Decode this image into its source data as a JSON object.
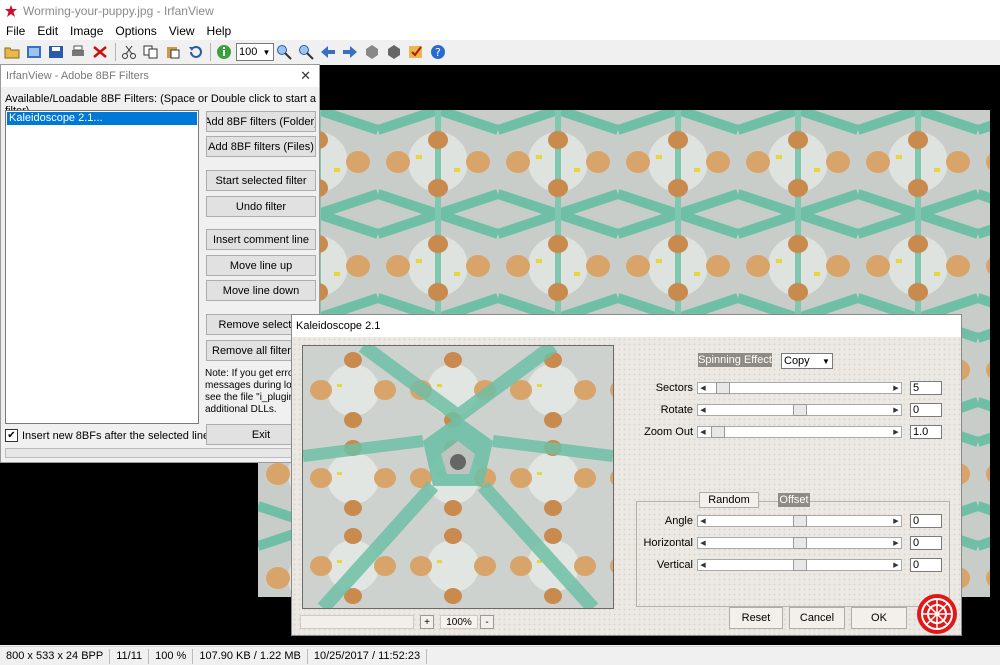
{
  "window": {
    "title": "Worming-your-puppy.jpg - IrfanView"
  },
  "menu": [
    "File",
    "Edit",
    "Image",
    "Options",
    "View",
    "Help"
  ],
  "toolbar": {
    "zoom_value": "100"
  },
  "status": {
    "dimensions": "800 x 533 x 24 BPP",
    "index": "11/11",
    "zoom": "100 %",
    "filesize": "107.90 KB / 1.22 MB",
    "datetime": "10/25/2017 / 11:52:23"
  },
  "filters_dialog": {
    "title": "IrfanView - Adobe 8BF Filters",
    "description": "Available/Loadable 8BF Filters: (Space or Double click to start a filter)",
    "list_items": [
      "Kaleidoscope 2.1..."
    ],
    "buttons": {
      "add_folder": "Add 8BF filters (Folder)",
      "add_files": "Add 8BF filters (Files)",
      "start": "Start selected filter",
      "undo": "Undo filter",
      "insert_comment": "Insert comment line",
      "move_up": "Move line up",
      "move_down": "Move line down",
      "remove_selected": "Remove selected",
      "remove_all": "Remove all filters/",
      "exit": "Exit"
    },
    "note": "Note: If you get erro messages during loa see the file \"i_plugin for additional DLLs.",
    "insert_checkbox": "Insert new 8BFs after the selected line"
  },
  "kaleidoscope": {
    "title": "Kaleidoscope 2.1",
    "spinning_effect_label": "Spinning Effect",
    "spinning_effect_value": "Copy",
    "sliders": {
      "sectors": {
        "label": "Sectors",
        "value": "5",
        "level": 0.05
      },
      "rotate": {
        "label": "Rotate",
        "value": "0",
        "level": 0.5
      },
      "zoom_out": {
        "label": "Zoom Out",
        "value": "1.0",
        "level": 0.02
      }
    },
    "offset_label": "Offset",
    "random_button": "Random",
    "offset_sliders": {
      "angle": {
        "label": "Angle",
        "value": "0",
        "level": 0.5
      },
      "horizontal": {
        "label": "Horizontal",
        "value": "0",
        "level": 0.5
      },
      "vertical": {
        "label": "Vertical",
        "value": "0",
        "level": 0.5
      }
    },
    "zoom_minus": "-",
    "zoom_plus": "+",
    "preview_zoom": "100%",
    "buttons": {
      "reset": "Reset",
      "cancel": "Cancel",
      "ok": "OK"
    }
  },
  "colors": {
    "selection": "#0078d7",
    "viewport": "#000000",
    "teal": "#6fbfa6"
  }
}
